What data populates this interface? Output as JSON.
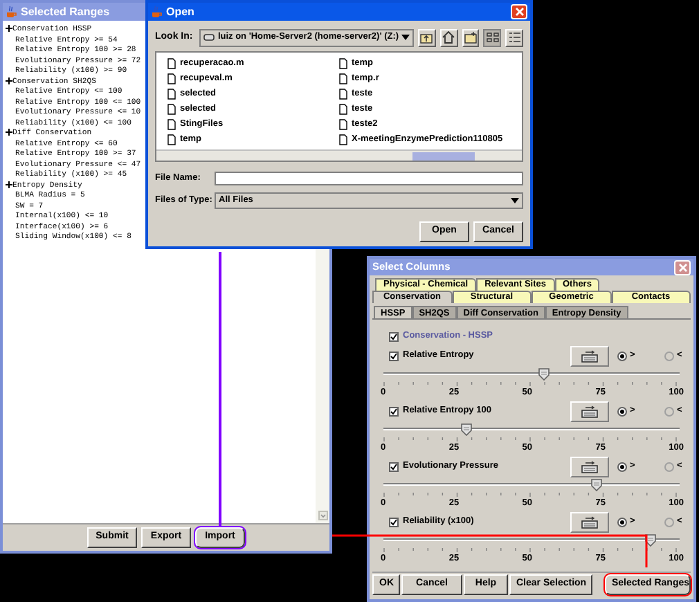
{
  "selected_ranges_window": {
    "title": "Selected Ranges",
    "tree": [
      {
        "label": "Conservation HSSP",
        "children": [
          "Relative Entropy >= 54",
          "Relative Entropy 100 >= 28",
          "Evolutionary Pressure >= 72",
          "Reliability (x100) >= 90"
        ]
      },
      {
        "label": "Conservation SH2QS",
        "children": [
          "Relative Entropy <= 100",
          "Relative Entropy 100 <= 100",
          "Evolutionary Pressure <= 10",
          "Reliability (x100) <= 100"
        ]
      },
      {
        "label": "Diff Conservation",
        "children": [
          "Relative Entropy <= 60",
          "Relative Entropy 100 >= 37",
          "Evolutionary Pressure <= 47",
          "Reliability (x100) >= 45"
        ]
      },
      {
        "label": "Entropy Density",
        "children": [
          "BLMA Radius = 5",
          "SW = 7",
          "Internal(x100) <= 10",
          "Interface(x100) >= 6",
          "Sliding Window(x100) <= 8"
        ]
      }
    ],
    "buttons": [
      {
        "label": "Submit"
      },
      {
        "label": "Export"
      },
      {
        "label": "Import",
        "color": "#8000ff"
      }
    ]
  },
  "open_dialog": {
    "title": "Open",
    "look_in_label": "Look In:",
    "look_in_value": "luiz on 'Home-Server2 (home-server2)' (Z:)",
    "files": [
      "recuperacao.m",
      "recupeval.m",
      "selected",
      "selected",
      "StingFiles",
      "temp",
      "temp",
      "temp.r",
      "teste",
      "teste",
      "teste2",
      "X-meetingEnzymePrediction110805"
    ],
    "file_name_label": "File Name:",
    "files_of_type_label": "Files of Type:",
    "files_of_type_value": "All Files",
    "buttons": [
      "Open",
      "Cancel"
    ]
  },
  "select_columns_window": {
    "title": "Select Columns",
    "tab_rows": [
      [
        {
          "label": "Physical - Chemical",
          "selected": false
        },
        {
          "label": "Relevant Sites",
          "selected": false
        },
        {
          "label": "Others",
          "selected": false
        }
      ],
      [
        {
          "label": "Conservation",
          "selected": true
        },
        {
          "label": "Structural",
          "selected": false
        },
        {
          "label": "Geometric",
          "selected": false
        },
        {
          "label": "Contacts",
          "selected": false
        }
      ]
    ],
    "subtabs": [
      {
        "label": "HSSP",
        "selected": true
      },
      {
        "label": "SH2QS",
        "selected": false
      },
      {
        "label": "Diff Conservation",
        "selected": false
      },
      {
        "label": "Entropy Density",
        "selected": false
      }
    ],
    "group_checkbox": {
      "label": "Conservation - HSSP",
      "checked": true
    },
    "measures": [
      {
        "label": "Relative Entropy",
        "checked": true,
        "radios": [
          {
            "label": ">",
            "selected": true
          },
          {
            "label": "<",
            "selected": false
          }
        ],
        "level": 0.54,
        "scale": [
          "0",
          "25",
          "50",
          "75",
          "100"
        ]
      },
      {
        "label": "Relative Entropy 100",
        "checked": true,
        "radios": [
          {
            "label": ">",
            "selected": true
          },
          {
            "label": "<",
            "selected": false
          }
        ],
        "level": 0.28,
        "scale": [
          "0",
          "25",
          "50",
          "75",
          "100"
        ]
      },
      {
        "label": "Evolutionary Pressure",
        "checked": true,
        "radios": [
          {
            "label": ">",
            "selected": true
          },
          {
            "label": "<",
            "selected": false
          }
        ],
        "level": 0.72,
        "scale": [
          "0",
          "25",
          "50",
          "75",
          "100"
        ]
      },
      {
        "label": "Reliability (x100)",
        "checked": true,
        "radios": [
          {
            "label": ">",
            "selected": true
          },
          {
            "label": "<",
            "selected": false
          }
        ],
        "level": 0.9,
        "scale": [
          "0",
          "25",
          "50",
          "75",
          "100"
        ]
      }
    ],
    "buttons": [
      {
        "label": "OK"
      },
      {
        "label": "Cancel"
      },
      {
        "label": "Help"
      },
      {
        "label": "Clear Selection"
      },
      {
        "label": "Selected Ranges",
        "color": "#ff0000"
      }
    ]
  }
}
